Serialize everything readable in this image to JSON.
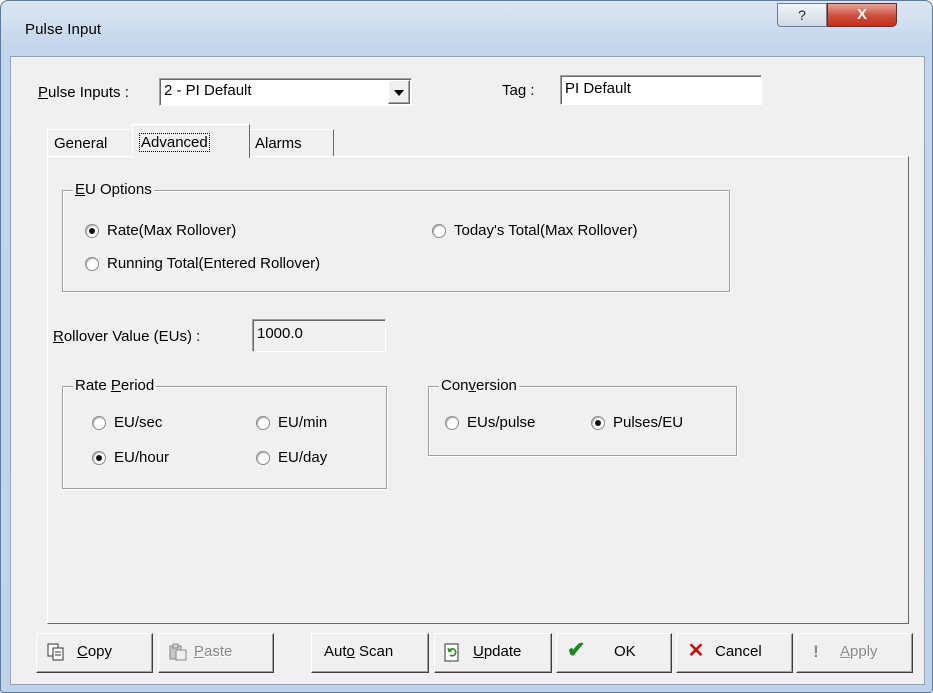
{
  "window": {
    "title": "Pulse Input",
    "help": "?",
    "close": "X"
  },
  "header": {
    "pulse_inputs_label_u": "P",
    "pulse_inputs_label_rest": "ulse Inputs :",
    "pulse_inputs_value": "2 - PI Default",
    "tag_label_a": "Ta",
    "tag_label_u": "g",
    "tag_label_b": " :",
    "tag_value": "PI Default"
  },
  "tabs": [
    {
      "label": "General"
    },
    {
      "label": "Advanced",
      "selected": true
    },
    {
      "label": "Alarms"
    }
  ],
  "eu_options": {
    "legend_u": "E",
    "legend_rest": "U Options",
    "options": [
      {
        "label": "Rate(Max Rollover)",
        "checked": true
      },
      {
        "label": "Today's Total(Max Rollover)",
        "checked": false
      },
      {
        "label": "Running Total(Entered Rollover)",
        "checked": false
      }
    ]
  },
  "rollover": {
    "label_u": "R",
    "label_rest": "ollover Value (EUs) :",
    "value": "1000.0"
  },
  "rate_period": {
    "legend_a": "Rate ",
    "legend_u": "P",
    "legend_b": "eriod",
    "options": [
      {
        "label": "EU/sec",
        "checked": false
      },
      {
        "label": "EU/min",
        "checked": false
      },
      {
        "label": "EU/hour",
        "checked": true
      },
      {
        "label": "EU/day",
        "checked": false
      }
    ]
  },
  "conversion": {
    "legend_a": "Con",
    "legend_u": "v",
    "legend_b": "ersion",
    "options": [
      {
        "label": "EUs/pulse",
        "checked": false
      },
      {
        "label": "Pulses/EU",
        "checked": true
      }
    ]
  },
  "buttons": {
    "copy": {
      "u": "C",
      "rest": "opy"
    },
    "paste": {
      "u": "P",
      "rest": "aste"
    },
    "auto_scan": {
      "a": "Aut",
      "u": "o",
      "b": " Scan"
    },
    "update": {
      "u": "U",
      "rest": "pdate"
    },
    "ok": "OK",
    "cancel": "Cancel",
    "apply": {
      "u": "A",
      "rest": "pply"
    }
  }
}
